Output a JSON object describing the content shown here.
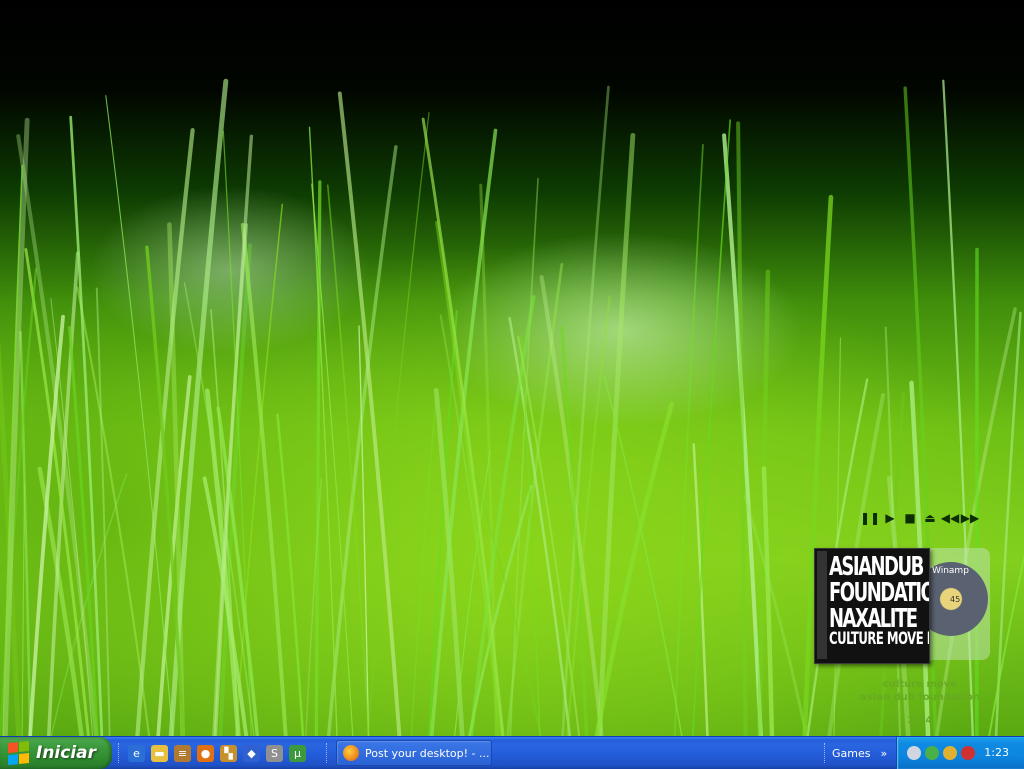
{
  "desktop": {
    "wallpaper": "green grass close-up"
  },
  "winamp": {
    "controls": [
      {
        "name": "pause-icon",
        "glyph": "❚❚"
      },
      {
        "name": "play-icon",
        "glyph": "▶"
      },
      {
        "name": "stop-icon",
        "glyph": "■"
      },
      {
        "name": "eject-icon",
        "glyph": "⏏"
      },
      {
        "name": "previous-icon",
        "glyph": "◀◀"
      },
      {
        "name": "next-icon",
        "glyph": "▶▶"
      }
    ],
    "album_lines": [
      "ASIANDUB",
      "FOUNDATION",
      "NAXALITE",
      "CULTURE MOVE EP"
    ],
    "cd_label": "Winamp",
    "cd_number": "45",
    "track_title": "culture move",
    "artist": "asian dub foundation",
    "time": "2:34"
  },
  "taskbar": {
    "start_label": "Iniciar",
    "quick_launch": [
      {
        "name": "internet-explorer-icon",
        "glyph": "e",
        "color": "#2b6fd6"
      },
      {
        "name": "folder-icon",
        "glyph": "▬",
        "color": "#e8c040"
      },
      {
        "name": "winrar-icon",
        "glyph": "≡",
        "color": "#b07a30"
      },
      {
        "name": "firefox-icon",
        "glyph": "●",
        "color": "#e07010"
      },
      {
        "name": "paint-icon",
        "glyph": "▚",
        "color": "#c8902a"
      },
      {
        "name": "media-player-icon",
        "glyph": "◆",
        "color": "#3060d0"
      },
      {
        "name": "messenger-icon",
        "glyph": "S",
        "color": "#909090"
      },
      {
        "name": "utorrent-icon",
        "glyph": "µ",
        "color": "#3c9a3c"
      }
    ],
    "task_label": "Post your desktop! - ...",
    "games_label": "Games",
    "games_chevron": "»",
    "tray": [
      {
        "name": "skype-tray-icon",
        "color": "#cfd6df"
      },
      {
        "name": "utorrent-tray-icon",
        "color": "#4ab04a"
      },
      {
        "name": "antivirus-tray-icon",
        "color": "#e0b030"
      },
      {
        "name": "network-tray-icon",
        "color": "#d03030"
      }
    ],
    "clock": "1:23"
  }
}
